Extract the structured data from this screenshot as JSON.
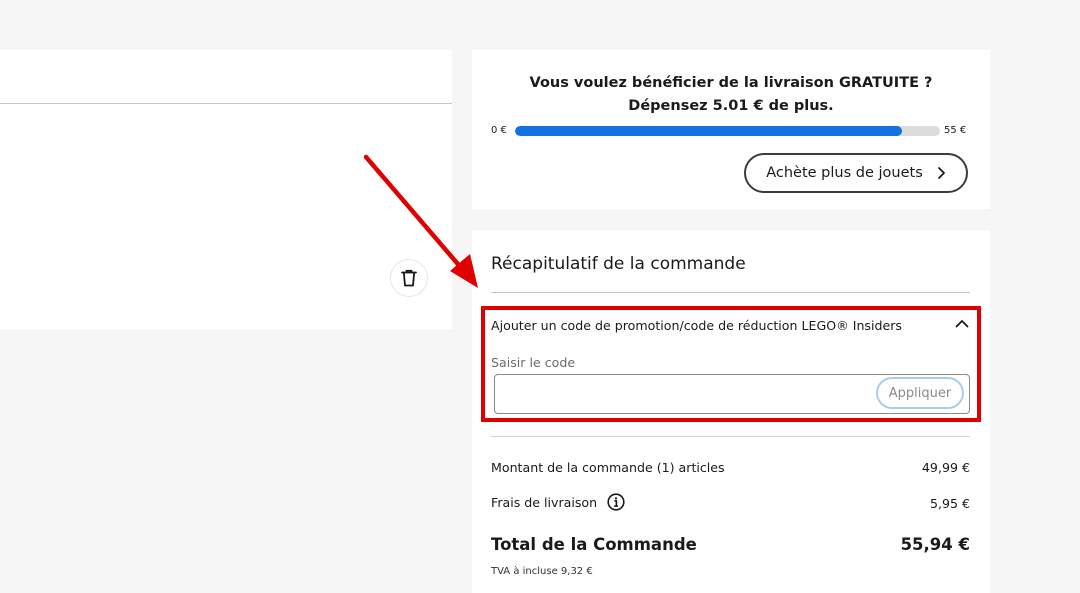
{
  "cart": {
    "delete_icon": "trash-icon"
  },
  "shipping": {
    "message": "Vous voulez bénéficier de la livraison GRATUITE ? Dépensez 5.01 € de plus.",
    "range_min": "0 €",
    "range_max": "55 €",
    "progress": 0.91,
    "shop_button": "Achète plus de jouets",
    "shop_icon": "chevron-right-icon",
    "accent_color": "#1570e0"
  },
  "summary": {
    "title": "Récapitulatif de la commande",
    "promo": {
      "header": "Ajouter un code de promotion/code de réduction LEGO® Insiders",
      "toggle_icon": "chevron-up-icon",
      "input_label": "Saisir le code",
      "input_value": "",
      "apply_button": "Appliquer",
      "highlight_color": "#e00000"
    },
    "order_amount_label": "Montant de la commande (1) articles",
    "order_amount_value": "49,99 €",
    "shipping_label": "Frais de livraison",
    "shipping_info_icon": "info-icon",
    "shipping_value": "5,95 €",
    "total_label": "Total de la Commande",
    "total_value": "55,94 €",
    "vat_note": "TVA à incluse 9,32 €"
  },
  "annotation": {
    "arrow_color": "#e00000"
  }
}
